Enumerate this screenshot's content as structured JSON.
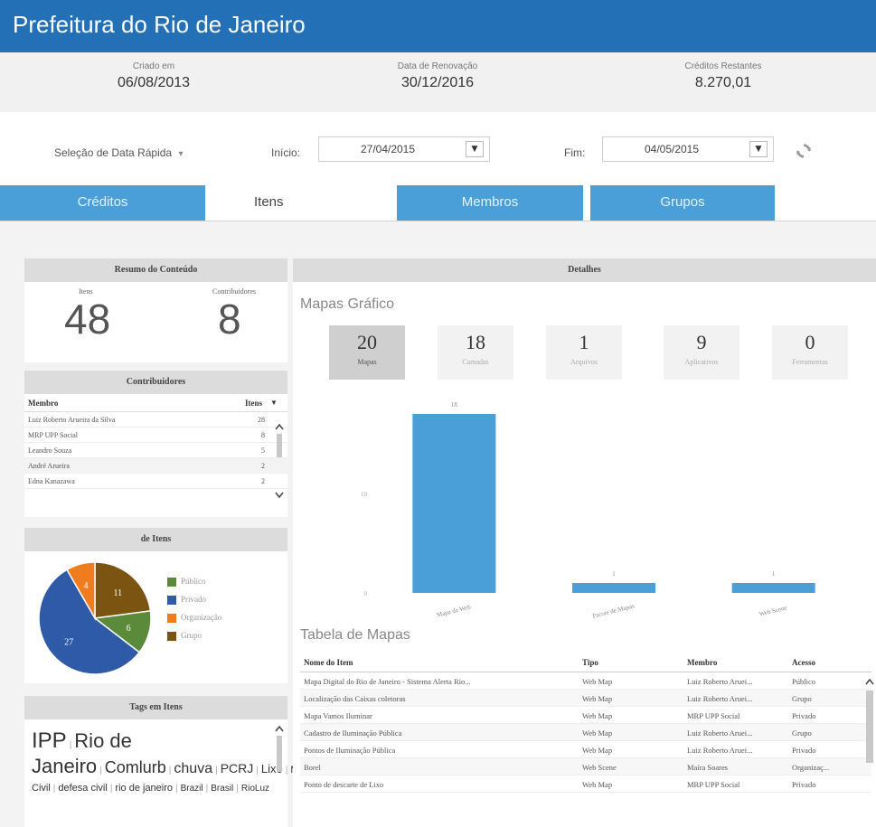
{
  "header": {
    "title": "Prefeitura do Rio de Janeiro"
  },
  "info": [
    {
      "label": "Criado em",
      "value": "06/08/2013"
    },
    {
      "label": "Data de Renovação",
      "value": "30/12/2016"
    },
    {
      "label": "Créditos Restantes",
      "value": "8.270,01"
    }
  ],
  "date_bar": {
    "quick_select": "Seleção de Data Rápida",
    "start_label": "Início:",
    "start_value": "27/04/2015",
    "end_label": "Fim:",
    "end_value": "04/05/2015",
    "dropdown_glyph": "▾",
    "caret_glyph": "▼",
    "refresh_icon": "refresh-icon"
  },
  "tabs": [
    {
      "label": "Créditos",
      "active": false
    },
    {
      "label": "Itens",
      "active": true
    },
    {
      "label": "Membros",
      "active": false
    },
    {
      "label": "Grupos",
      "active": false
    }
  ],
  "summary": {
    "title": "Resumo do Conteúdo",
    "items_label": "Itens",
    "items_count": "48",
    "contrib_label": "Contribuidores",
    "contrib_count": "8"
  },
  "contributors": {
    "title": "Contribuidores",
    "col_member": "Membro",
    "col_items": "Itens",
    "rows": [
      {
        "name": "Luiz Roberto Arueira da Silva",
        "items": "28"
      },
      {
        "name": "MRP UPP Social",
        "items": "8"
      },
      {
        "name": "Leandro Souza",
        "items": "5"
      },
      {
        "name": "André Arueira",
        "items": "2"
      },
      {
        "name": "Edna Kanazawa",
        "items": "2"
      }
    ]
  },
  "access_pie": {
    "title": "de Itens",
    "slices": [
      {
        "label": "Público",
        "value": 6,
        "color": "#5a8a3a"
      },
      {
        "label": "Privado",
        "value": 27,
        "color": "#2e5aa8"
      },
      {
        "label": "Organização",
        "value": 4,
        "color": "#f07c20"
      },
      {
        "label": "Grupo",
        "value": 11,
        "color": "#7a5410"
      }
    ]
  },
  "tags": {
    "title": "Tags em Itens",
    "items": [
      {
        "text": "IPP",
        "size": 24
      },
      {
        "text": "Rio de Janeiro",
        "size": 22
      },
      {
        "text": "Comlurb",
        "size": 18
      },
      {
        "text": "chuva",
        "size": 16
      },
      {
        "text": "PCRJ",
        "size": 14
      },
      {
        "text": "Lixo",
        "size": 13
      },
      {
        "text": "MRP",
        "size": 11
      },
      {
        "text": "Defesa Civil",
        "size": 11
      },
      {
        "text": "defesa civil",
        "size": 11
      },
      {
        "text": "rio de janeiro",
        "size": 11
      },
      {
        "text": "Brazil",
        "size": 10
      },
      {
        "text": "Brasil",
        "size": 10
      },
      {
        "text": "RioLuz",
        "size": 10
      }
    ]
  },
  "details": {
    "title": "Detalhes",
    "chart_section_title": "Mapas Gráfico",
    "cards": [
      {
        "value": "20",
        "label": "Mapas",
        "active": true
      },
      {
        "value": "18",
        "label": "Camadas",
        "active": false
      },
      {
        "value": "1",
        "label": "Arquivos",
        "active": false
      },
      {
        "value": "9",
        "label": "Aplicativos",
        "active": false
      },
      {
        "value": "0",
        "label": "Ferramentas",
        "active": false
      }
    ],
    "table_title": "Tabela de Mapas"
  },
  "chart_data": {
    "type": "bar",
    "categories": [
      "Mapa da Web",
      "Pacote de Mapas",
      "Web Scene"
    ],
    "values": [
      18,
      1,
      1
    ],
    "ylim": [
      0,
      20
    ],
    "yticks": [
      0,
      10
    ],
    "color": "#4a9fd8",
    "title": "",
    "xlabel": "",
    "ylabel": ""
  },
  "maps_table": {
    "columns": [
      "Nome do Item",
      "Tipo",
      "Membro",
      "Acesso"
    ],
    "rows": [
      [
        "Mapa Digital do Rio de Janeiro - Sistema Alerta Rio...",
        "Web Map",
        "Luiz Roberto Aruei...",
        "Público"
      ],
      [
        "Localização das Caixas coletoras",
        "Web Map",
        "Luiz Roberto Aruei...",
        "Grupo"
      ],
      [
        "Mapa Vamos Iluminar",
        "Web Map",
        "MRP UPP Social",
        "Privado"
      ],
      [
        "Cadastro de Iluminação Pública",
        "Web Map",
        "Luiz Roberto Aruei...",
        "Grupo"
      ],
      [
        "Pontos de Iluminação Pública",
        "Web Map",
        "Luiz Roberto Aruei...",
        "Privado"
      ],
      [
        "Borel",
        "Web Scene",
        "Maíra Soares",
        "Organizaç..."
      ],
      [
        "Ponto de descarte de Lixo",
        "Web Map",
        "MRP UPP Social",
        "Privado"
      ]
    ]
  }
}
